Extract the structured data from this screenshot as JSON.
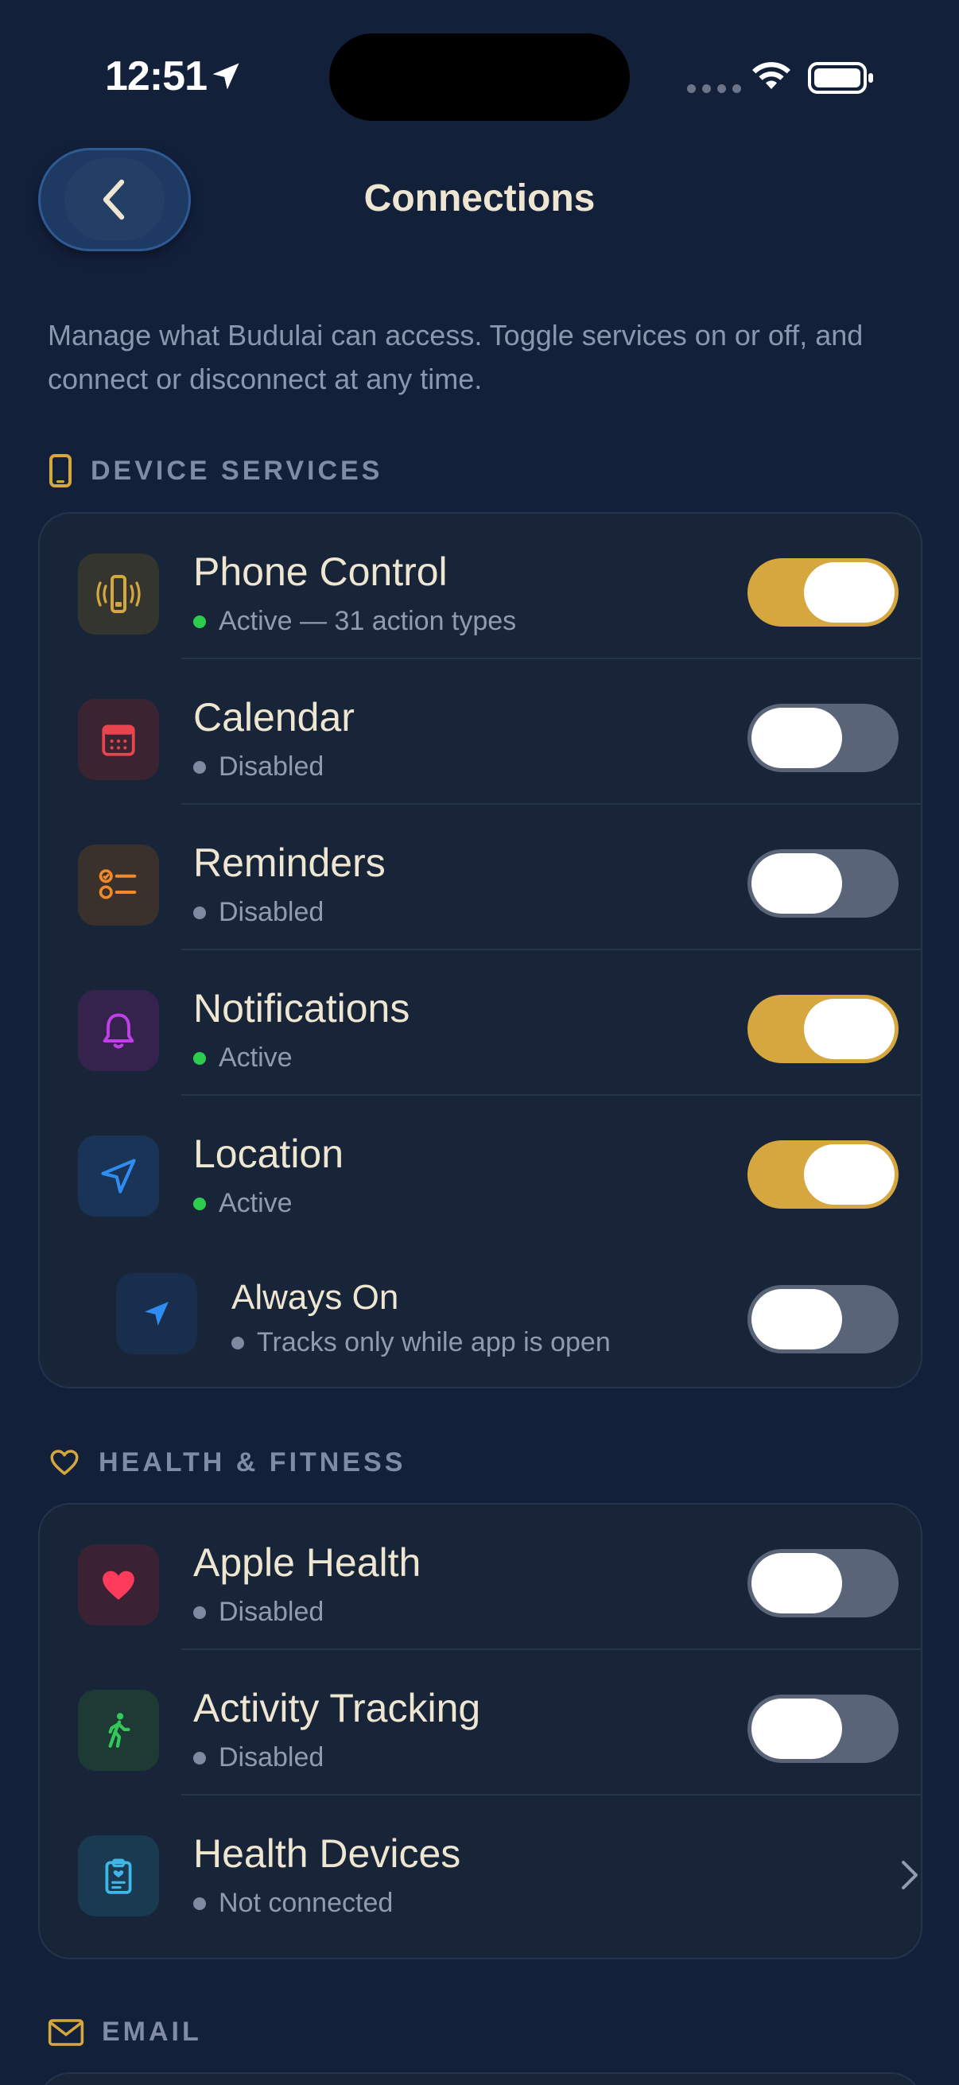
{
  "status_bar": {
    "time": "12:51"
  },
  "header": {
    "title": "Connections"
  },
  "intro": "Manage what Budulai can access. Toggle services on or off, and connect or disconnect at any time.",
  "sections": {
    "device": {
      "label": "DEVICE SERVICES",
      "items": [
        {
          "title": "Phone Control",
          "status": "Active — 31 action types",
          "enabled": true,
          "icon": "phone-vibrate-icon",
          "icon_color": "#d6a73f"
        },
        {
          "title": "Calendar",
          "status": "Disabled",
          "enabled": false,
          "icon": "calendar-icon",
          "icon_color": "#e8454f"
        },
        {
          "title": "Reminders",
          "status": "Disabled",
          "enabled": false,
          "icon": "checklist-icon",
          "icon_color": "#f08a2a"
        },
        {
          "title": "Notifications",
          "status": "Active",
          "enabled": true,
          "icon": "bell-icon",
          "icon_color": "#c040e8"
        },
        {
          "title": "Location",
          "status": "Active",
          "enabled": true,
          "icon": "location-arrow-icon",
          "icon_color": "#2f8cf0"
        },
        {
          "title": "Always On",
          "status": "Tracks only while app is open",
          "enabled": false,
          "icon": "location-fill-icon",
          "icon_color": "#2f8cf0"
        }
      ]
    },
    "health": {
      "label": "HEALTH & FITNESS",
      "items": [
        {
          "title": "Apple Health",
          "status": "Disabled",
          "enabled": false,
          "icon": "heart-icon",
          "icon_color": "#ff3b5c"
        },
        {
          "title": "Activity Tracking",
          "status": "Disabled",
          "enabled": false,
          "icon": "walking-icon",
          "icon_color": "#34c759"
        },
        {
          "title": "Health Devices",
          "status": "Not connected",
          "icon": "clipboard-icon",
          "icon_color": "#3fb8e8"
        }
      ]
    },
    "email": {
      "label": "EMAIL"
    }
  },
  "colors": {
    "accent": "#d6a73f",
    "active": "#2ecc4e",
    "background": "#13203a"
  }
}
